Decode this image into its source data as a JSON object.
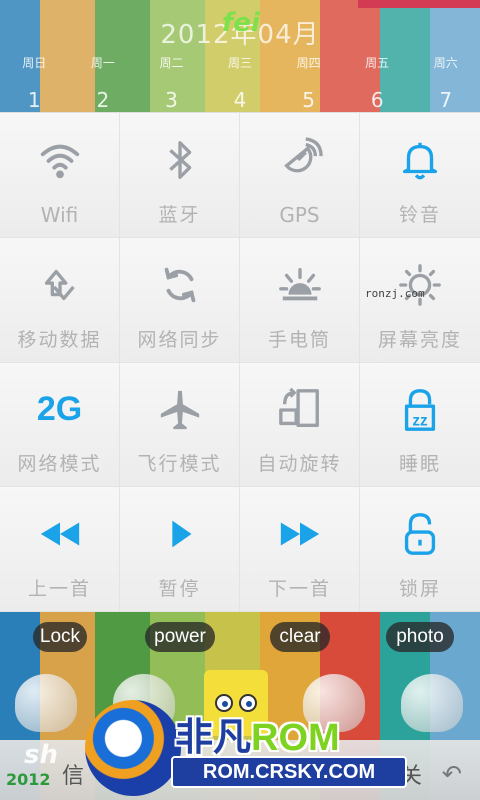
{
  "calendar": {
    "title": "2012年04月",
    "overlay": "fei",
    "weekdays": [
      "周日",
      "周一",
      "周二",
      "周三",
      "周四",
      "周五",
      "周六"
    ],
    "dates": [
      "1",
      "2",
      "3",
      "4",
      "5",
      "6",
      "7"
    ]
  },
  "watermark": "ronzj.com",
  "toggles": [
    {
      "label": "Wifi",
      "icon": "wifi-icon",
      "active": false
    },
    {
      "label": "蓝牙",
      "icon": "bluetooth-icon",
      "active": false
    },
    {
      "label": "GPS",
      "icon": "gps-icon",
      "active": false
    },
    {
      "label": "铃音",
      "icon": "bell-icon",
      "active": true
    },
    {
      "label": "移动数据",
      "icon": "mobile-data-icon",
      "active": false
    },
    {
      "label": "网络同步",
      "icon": "sync-icon",
      "active": false
    },
    {
      "label": "手电筒",
      "icon": "flashlight-icon",
      "active": false
    },
    {
      "label": "屏幕亮度",
      "icon": "brightness-icon",
      "active": false
    },
    {
      "label": "网络模式",
      "icon": "network-mode-icon",
      "active": true,
      "text": "2G"
    },
    {
      "label": "飞行模式",
      "icon": "airplane-icon",
      "active": false
    },
    {
      "label": "自动旋转",
      "icon": "auto-rotate-icon",
      "active": false
    },
    {
      "label": "睡眠",
      "icon": "sleep-icon",
      "active": true
    },
    {
      "label": "上一首",
      "icon": "previous-track-icon",
      "active": true
    },
    {
      "label": "暂停",
      "icon": "play-icon",
      "active": true
    },
    {
      "label": "下一首",
      "icon": "next-track-icon",
      "active": true
    },
    {
      "label": "锁屏",
      "icon": "lock-icon",
      "active": true
    }
  ],
  "pills": [
    "Lock",
    "power",
    "clear",
    "photo"
  ],
  "brand": {
    "title_a": "非凡",
    "title_b": "ROM",
    "subtitle": "ROM.CRSKY.COM"
  },
  "bottombar": {
    "year": "2012",
    "sh": "sh",
    "char_left": "信",
    "char_right": "关",
    "back": "↶"
  },
  "colors": {
    "active": "#1aa3e8",
    "inactive": "#9aa0a6",
    "label": "#b3b3b3",
    "brand_blue": "#1e3fa0",
    "brand_green": "#7ed321"
  }
}
